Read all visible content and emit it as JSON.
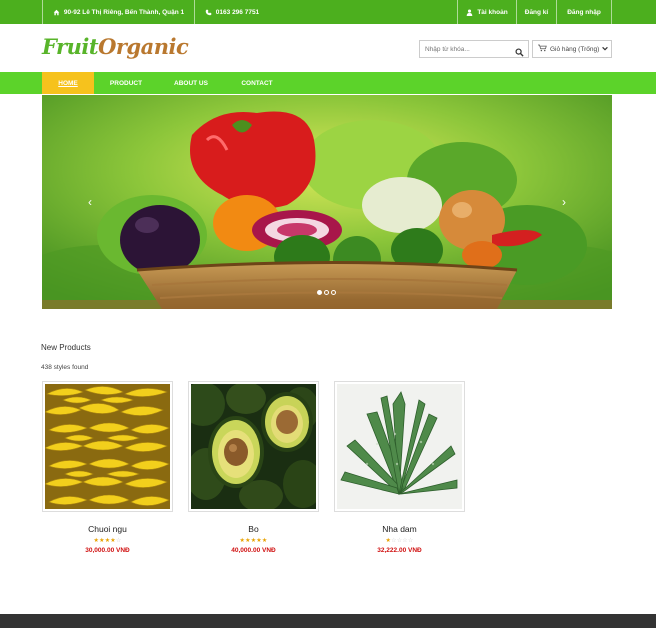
{
  "topbar": {
    "address": "90-92 Lê Thị Riêng, Bến Thành, Quận 1",
    "phone": "0163 296 7751",
    "account": "Tài khoản",
    "register": "Đăng kí",
    "login": "Đăng nhập"
  },
  "header": {
    "logo_part1": "Fruit",
    "logo_part2": "Organic",
    "search_placeholder": "Nhập từ khóa...",
    "cart_label": "Giỏ hàng (Trống)"
  },
  "nav": {
    "items": [
      "HOME",
      "PRODUCT",
      "ABOUT US",
      "CONTACT"
    ]
  },
  "banner": {
    "slide_count": 3,
    "active_slide": 1
  },
  "products": {
    "title": "New Products",
    "count_text": "438 styles found",
    "items": [
      {
        "name": "Chuoi ngu",
        "rating": 4,
        "price": "30,000.00 VNĐ"
      },
      {
        "name": "Bo",
        "rating": 5,
        "price": "40,000.00 VNĐ"
      },
      {
        "name": "Nha dam",
        "rating": 1,
        "price": "32,222.00 VNĐ"
      }
    ]
  },
  "colors": {
    "topbar": "#4caf1e",
    "nav": "#5cd32a",
    "nav_active": "#f6c21d",
    "price": "#d01010",
    "footer": "#333333"
  }
}
